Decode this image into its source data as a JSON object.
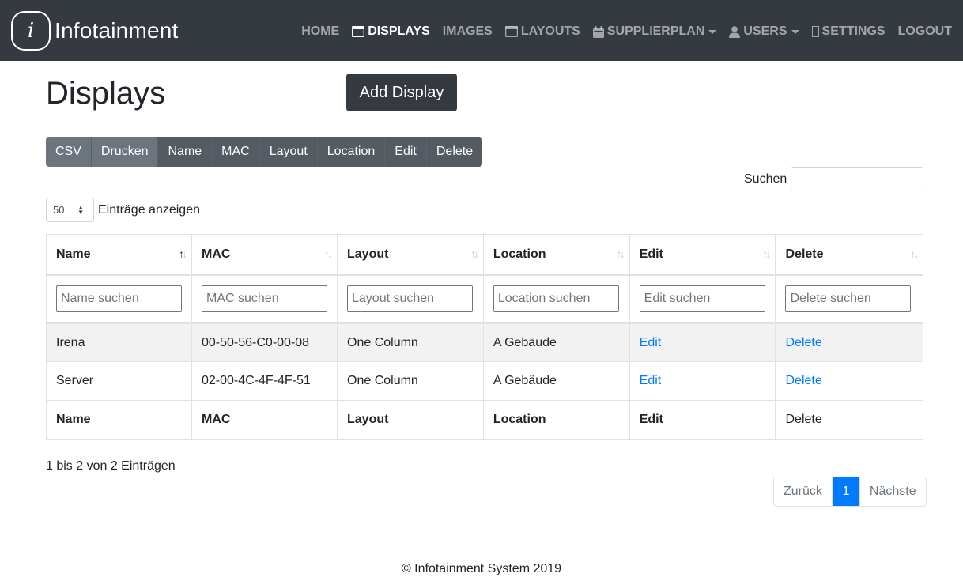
{
  "app": {
    "logo_letter": "i",
    "title": "Infotainment"
  },
  "nav": {
    "home": "HOME",
    "displays": "DISPLAYS",
    "images": "IMAGES",
    "layouts": "LAYOUTS",
    "supplierplan": "SUPPLIERPLAN",
    "users": "USERS",
    "settings": "SETTINGS",
    "logout": "LOGOUT"
  },
  "page": {
    "title": "Displays",
    "add_button": "Add Display"
  },
  "buttons": [
    "CSV",
    "Drucken",
    "Name",
    "MAC",
    "Layout",
    "Location",
    "Edit",
    "Delete"
  ],
  "search": {
    "label": "Suchen",
    "value": ""
  },
  "length": {
    "value": "50",
    "label": "Einträge anzeigen"
  },
  "table": {
    "columns": [
      "Name",
      "MAC",
      "Layout",
      "Location",
      "Edit",
      "Delete"
    ],
    "filters": [
      "Name suchen",
      "MAC suchen",
      "Layout suchen",
      "Location suchen",
      "Edit suchen",
      "Delete suchen"
    ],
    "rows": [
      {
        "name": "Irena",
        "mac": "00-50-56-C0-00-08",
        "layout": "One Column",
        "location": "A Gebäude",
        "edit": "Edit",
        "delete": "Delete"
      },
      {
        "name": "Server",
        "mac": "02-00-4C-4F-4F-51",
        "layout": "One Column",
        "location": "A Gebäude",
        "edit": "Edit",
        "delete": "Delete"
      }
    ],
    "footer": [
      "Name",
      "MAC",
      "Layout",
      "Location",
      "Edit",
      "Delete"
    ]
  },
  "info": "1 bis 2 von 2 Einträgen",
  "pagination": {
    "prev": "Zurück",
    "current": "1",
    "next": "Nächste"
  },
  "footer": "© Infotainment System 2019",
  "colors": {
    "navbar": "#343a40",
    "link": "#007bff",
    "button_secondary": "#6c757d",
    "page_active": "#007bff"
  }
}
